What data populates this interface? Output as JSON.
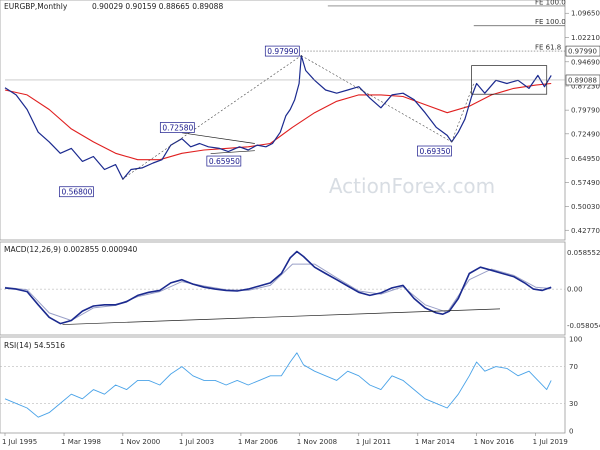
{
  "chart_data": [
    {
      "type": "line",
      "pane": "price",
      "title": "EURGBP,Monthly",
      "ohlc": "0.90029 0.90159 0.88665 0.89088",
      "watermark": "ActionForex.com",
      "yticks": [
        0.4277,
        0.5003,
        0.5749,
        0.6495,
        0.7249,
        0.7979,
        0.8723,
        0.9469,
        1.0221,
        1.0965
      ],
      "ytick_labels": [
        "0.42770",
        "0.50030",
        "0.57490",
        "0.64950",
        "0.72490",
        "0.79790",
        "0.87230",
        "0.94690",
        "1.02210",
        "1.09650"
      ],
      "ylim": [
        0.41,
        1.125
      ],
      "xlim": [
        1995.5,
        2020.6
      ],
      "xtick_labels": [
        "1 Jul 1995",
        "1 Mar 1998",
        "1 Nov 2000",
        "1 Jul 2003",
        "1 Mar 2006",
        "1 Nov 2008",
        "1 Jul 2011",
        "1 Mar 2014",
        "1 Nov 2016",
        "1 Jul 2019"
      ],
      "xtick_values": [
        1995.5,
        1998.17,
        2000.83,
        2003.5,
        2006.17,
        2008.83,
        2011.5,
        2014.17,
        2016.83,
        2019.5
      ],
      "current_price": {
        "value": 0.89088,
        "label": "0.89088"
      },
      "fib_levels": [
        {
          "label": "FE 100.0",
          "value": 1.119
        },
        {
          "label": "FE 100.0",
          "value": 1.058
        },
        {
          "label": "FE 61.8",
          "value": 0.9799,
          "tag": "0.97990"
        }
      ],
      "annotations": [
        {
          "label": "0.97990",
          "x": 2008.9,
          "y": 0.9799
        },
        {
          "label": "0.72580",
          "x": 2003.7,
          "y": 0.7258
        },
        {
          "label": "0.65950",
          "x": 2004.9,
          "y": 0.6595
        },
        {
          "label": "0.56800",
          "x": 1999.5,
          "y": 0.568
        },
        {
          "label": "0.69350",
          "x": 2015.6,
          "y": 0.6935
        }
      ],
      "series": [
        {
          "name": "",
          "color": "#1b2a8f",
          "x": [
            1995.5,
            1996.0,
            1996.5,
            1997.0,
            1997.5,
            1998.0,
            1998.5,
            1999.0,
            1999.5,
            2000.0,
            2000.5,
            2000.83,
            2001.2,
            2001.7,
            2002.2,
            2002.6,
            2003.0,
            2003.5,
            2003.9,
            2004.3,
            2004.7,
            2005.2,
            2005.6,
            2006.1,
            2006.5,
            2006.9,
            2007.3,
            2007.6,
            2007.95,
            2008.2,
            2008.4,
            2008.6,
            2008.8,
            2008.9,
            2009.1,
            2009.5,
            2010.0,
            2010.5,
            2011.0,
            2011.5,
            2012.0,
            2012.5,
            2013.0,
            2013.5,
            2014.0,
            2014.5,
            2015.0,
            2015.5,
            2015.7,
            2016.0,
            2016.3,
            2016.6,
            2016.83,
            2017.2,
            2017.7,
            2018.2,
            2018.7,
            2019.2,
            2019.6,
            2019.9,
            2020.2
          ],
          "y": [
            0.867,
            0.845,
            0.8,
            0.73,
            0.7,
            0.665,
            0.68,
            0.64,
            0.655,
            0.615,
            0.63,
            0.585,
            0.615,
            0.62,
            0.635,
            0.645,
            0.69,
            0.71,
            0.685,
            0.695,
            0.685,
            0.68,
            0.67,
            0.685,
            0.675,
            0.69,
            0.685,
            0.695,
            0.73,
            0.78,
            0.8,
            0.83,
            0.88,
            0.966,
            0.92,
            0.89,
            0.86,
            0.85,
            0.86,
            0.87,
            0.835,
            0.805,
            0.845,
            0.85,
            0.83,
            0.79,
            0.745,
            0.72,
            0.7,
            0.73,
            0.77,
            0.84,
            0.88,
            0.85,
            0.89,
            0.88,
            0.89,
            0.865,
            0.905,
            0.87,
            0.905
          ]
        },
        {
          "name": "",
          "color": "#e02020",
          "x": [
            1995.5,
            1996.5,
            1997.5,
            1998.5,
            1999.5,
            2000.5,
            2001.5,
            2002.5,
            2003.5,
            2004.5,
            2005.5,
            2006.5,
            2007.5,
            2008.5,
            2009.5,
            2010.5,
            2011.5,
            2012.5,
            2013.5,
            2014.5,
            2015.5,
            2016.5,
            2017.5,
            2018.5,
            2019.5,
            2020.2
          ],
          "y": [
            0.86,
            0.845,
            0.8,
            0.74,
            0.7,
            0.665,
            0.645,
            0.645,
            0.665,
            0.675,
            0.68,
            0.685,
            0.695,
            0.745,
            0.79,
            0.825,
            0.845,
            0.845,
            0.84,
            0.815,
            0.79,
            0.81,
            0.845,
            0.865,
            0.875,
            0.88
          ]
        }
      ]
    },
    {
      "type": "line",
      "pane": "macd",
      "title": "MACD(12,26,9) 0.002855 0.000940",
      "ylim": [
        -0.07,
        0.072
      ],
      "ytick_values": [
        0.058552,
        0.0,
        -0.058054
      ],
      "ytick_labels": [
        "0.058552",
        "0.00",
        "-0.058054"
      ],
      "trendline": [
        [
          1998.1,
          -0.0565
        ],
        [
          2021.5,
          -0.027
        ]
      ],
      "series": [
        {
          "name": "",
          "color": "#1b2a8f",
          "x": [
            1995.5,
            1996.0,
            1996.5,
            1997.0,
            1997.5,
            1998.0,
            1998.5,
            1999.0,
            1999.5,
            2000.0,
            2000.5,
            2001.0,
            2001.5,
            2002.0,
            2002.5,
            2003.0,
            2003.5,
            2004.0,
            2004.5,
            2005.0,
            2005.5,
            2006.0,
            2006.5,
            2007.0,
            2007.5,
            2008.0,
            2008.4,
            2008.7,
            2009.0,
            2009.5,
            2010.0,
            2010.5,
            2011.0,
            2011.5,
            2012.0,
            2012.5,
            2013.0,
            2013.5,
            2014.0,
            2014.5,
            2015.0,
            2015.3,
            2015.6,
            2016.0,
            2016.5,
            2017.0,
            2017.5,
            2018.0,
            2018.5,
            2019.0,
            2019.4,
            2019.8,
            2020.2
          ],
          "y": [
            0.002,
            0.0,
            -0.004,
            -0.025,
            -0.045,
            -0.055,
            -0.05,
            -0.035,
            -0.027,
            -0.025,
            -0.025,
            -0.02,
            -0.01,
            -0.005,
            -0.002,
            0.01,
            0.015,
            0.008,
            0.003,
            0.0,
            -0.002,
            -0.003,
            0.0,
            0.005,
            0.01,
            0.025,
            0.05,
            0.06,
            0.052,
            0.035,
            0.025,
            0.015,
            0.005,
            -0.005,
            -0.01,
            -0.006,
            0.002,
            0.006,
            -0.015,
            -0.03,
            -0.038,
            -0.04,
            -0.035,
            -0.015,
            0.025,
            0.035,
            0.03,
            0.025,
            0.02,
            0.01,
            0.0,
            -0.002,
            0.003
          ]
        },
        {
          "name": "",
          "color": "#9aa0c8",
          "x": [
            1995.5,
            1996.5,
            1997.5,
            1998.5,
            1999.5,
            2000.5,
            2001.5,
            2002.5,
            2003.5,
            2004.5,
            2005.5,
            2006.5,
            2007.5,
            2008.5,
            2009.5,
            2010.5,
            2011.5,
            2012.5,
            2013.5,
            2014.5,
            2015.5,
            2016.5,
            2017.5,
            2018.5,
            2019.5,
            2020.2
          ],
          "y": [
            0.003,
            -0.001,
            -0.038,
            -0.05,
            -0.03,
            -0.026,
            -0.012,
            -0.004,
            0.012,
            0.005,
            -0.001,
            -0.002,
            0.006,
            0.04,
            0.04,
            0.018,
            -0.003,
            -0.008,
            0.004,
            -0.025,
            -0.037,
            0.015,
            0.032,
            0.022,
            0.003,
            0.001
          ]
        }
      ]
    },
    {
      "type": "line",
      "pane": "rsi",
      "title": "RSI(14) 54.5516",
      "ylim": [
        0,
        100
      ],
      "ytick_values": [
        100,
        70,
        30,
        0
      ],
      "ytick_labels": [
        "100",
        "70",
        "30",
        "0"
      ],
      "series": [
        {
          "name": "",
          "color": "#4aa3e8",
          "x": [
            1995.5,
            1996.0,
            1996.5,
            1997.0,
            1997.5,
            1998.0,
            1998.5,
            1999.0,
            1999.5,
            2000.0,
            2000.5,
            2001.0,
            2001.5,
            2002.0,
            2002.5,
            2003.0,
            2003.5,
            2004.0,
            2004.5,
            2005.0,
            2005.5,
            2006.0,
            2006.5,
            2007.0,
            2007.5,
            2008.0,
            2008.4,
            2008.7,
            2009.0,
            2009.5,
            2010.0,
            2010.5,
            2011.0,
            2011.5,
            2012.0,
            2012.5,
            2013.0,
            2013.5,
            2014.0,
            2014.5,
            2015.0,
            2015.5,
            2016.0,
            2016.5,
            2016.83,
            2017.2,
            2017.7,
            2018.2,
            2018.7,
            2019.2,
            2019.6,
            2020.0,
            2020.2
          ],
          "y": [
            35,
            30,
            25,
            15,
            20,
            30,
            40,
            35,
            45,
            40,
            50,
            45,
            55,
            55,
            50,
            62,
            70,
            60,
            55,
            55,
            50,
            55,
            50,
            55,
            60,
            60,
            75,
            85,
            72,
            65,
            60,
            55,
            65,
            60,
            50,
            45,
            60,
            55,
            45,
            35,
            30,
            25,
            40,
            60,
            75,
            65,
            70,
            68,
            60,
            65,
            55,
            45,
            55
          ]
        }
      ]
    }
  ]
}
